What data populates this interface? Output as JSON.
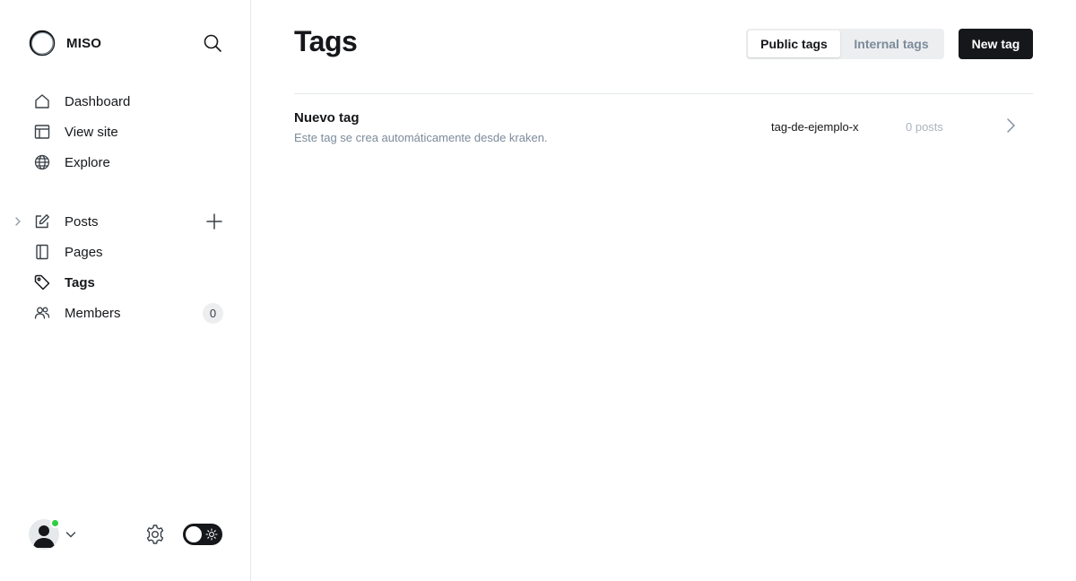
{
  "brand": {
    "name": "MISO"
  },
  "nav_primary": [
    {
      "label": "Dashboard",
      "icon": "home-icon"
    },
    {
      "label": "View site",
      "icon": "layout-icon"
    },
    {
      "label": "Explore",
      "icon": "globe-icon"
    }
  ],
  "nav_secondary": [
    {
      "label": "Posts",
      "icon": "pencil-square-icon"
    },
    {
      "label": "Pages",
      "icon": "page-icon"
    },
    {
      "label": "Tags",
      "icon": "tag-icon",
      "active": true
    },
    {
      "label": "Members",
      "icon": "members-icon",
      "count": "0"
    }
  ],
  "page": {
    "title": "Tags",
    "tabs": {
      "public": "Public tags",
      "internal": "Internal tags"
    },
    "new_button": "New tag"
  },
  "tags": [
    {
      "name": "Nuevo tag",
      "description": "Este tag se crea automáticamente desde kraken.",
      "slug": "tag-de-ejemplo-x",
      "count": "0 posts"
    }
  ],
  "colors": {
    "text": "#15171a",
    "muted": "#7c8b9a",
    "online": "#30cf43",
    "border": "#e6e9eb"
  }
}
